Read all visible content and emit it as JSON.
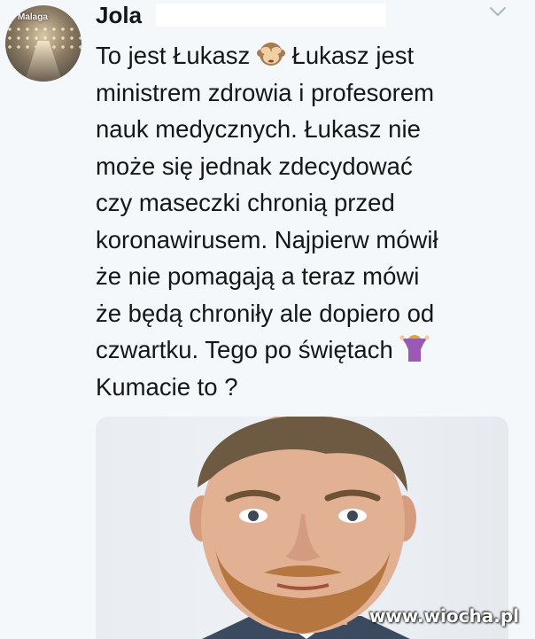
{
  "tweet": {
    "author_name": "Jola",
    "avatar_caption": "Malaga",
    "text_lines": [
      [
        "To jest Łukasz ",
        "monkey-emoji",
        " Łukasz jest"
      ],
      [
        "ministrem zdrowia i profesorem"
      ],
      [
        "nauk medycznych. Łukasz nie"
      ],
      [
        "może się jednak zdecydować"
      ],
      [
        "czy maseczki chronią przed"
      ],
      [
        "koronawirusem. Najpierw mówił"
      ],
      [
        "że nie pomagają a teraz mówi"
      ],
      [
        "że będą chroniły ale dopiero od"
      ],
      [
        "czwartku. Tego po świętach ",
        "shrug-emoji"
      ],
      [
        "Kumacie to ?"
      ]
    ]
  },
  "line1": {
    "a": "To jest Łukasz",
    "b": "Łukasz jest"
  },
  "line2": "ministrem zdrowia i profesorem",
  "line3": "nauk medycznych. Łukasz nie",
  "line4": "może się jednak zdecydować",
  "line5": "czy maseczki chronią przed",
  "line6": "koronawirusem. Najpierw mówił",
  "line7": "że nie pomagają a teraz mówi",
  "line8": "że będą chroniły ale dopiero od",
  "line9": "czwartku. Tego po świętach",
  "line10": "Kumacie to ?",
  "watermark": "www.wiocha.pl",
  "icons": {
    "menu": "chevron-down-icon",
    "emoji1": "see-no-evil-monkey",
    "emoji2": "woman-shrugging"
  },
  "colors": {
    "background": "#f5f8fa",
    "text": "#14171a",
    "chevron": "#aab8c2"
  }
}
